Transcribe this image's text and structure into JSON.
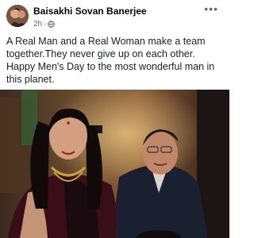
{
  "post": {
    "author": "Baisakhi Sovan Banerjee",
    "time": "2h",
    "separator": "·",
    "privacy_icon": "globe-icon",
    "more_icon": "more-dots-icon",
    "more_label": "•••",
    "caption_lines": [
      "A Real Man and a Real Woman make a team together.They never give up on each other.",
      "Happy Men's Day to the most wonderful man in this planet."
    ],
    "photo_icon": "couple-photo"
  }
}
